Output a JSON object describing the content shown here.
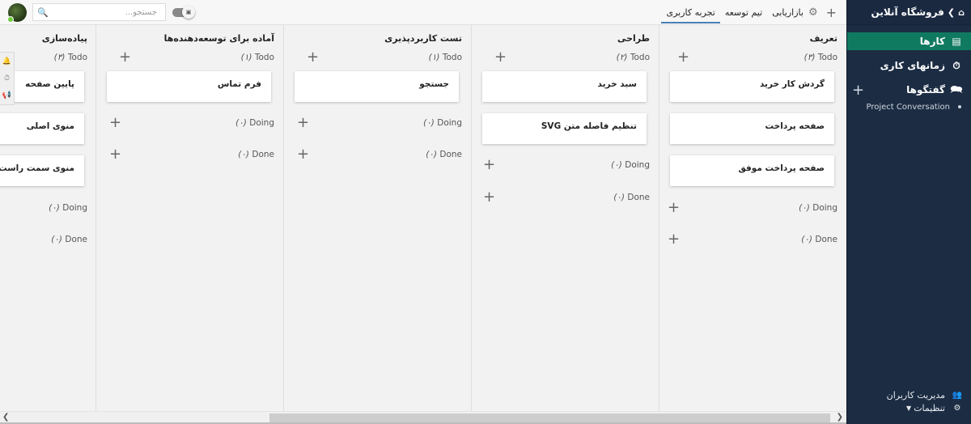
{
  "sidebar": {
    "title": "فروشگاه آنلاین",
    "items": [
      {
        "label": "کارها",
        "icon": "tasks-icon",
        "active": true
      },
      {
        "label": "زمانهای کاری",
        "icon": "stopwatch-icon",
        "active": false
      },
      {
        "label": "گفتگوها",
        "icon": "chat-icon",
        "active": false
      }
    ],
    "conversation": "Project Conversation",
    "bottom": {
      "users": "مدیریت کاربران",
      "settings": "تنظیمات"
    }
  },
  "topbar": {
    "tabs": [
      {
        "label": "تجربه کاربری",
        "active": true
      },
      {
        "label": "تیم توسعه",
        "active": false
      },
      {
        "label": "بازاریابی",
        "active": false
      }
    ],
    "search_placeholder": "جستجو..."
  },
  "board": {
    "columns": [
      {
        "title": "تعریف",
        "todo": "Todo",
        "todo_count": "(۳)",
        "doing": "Doing",
        "doing_count": "(۰)",
        "done": "Done",
        "done_count": "(۰)",
        "cards": [
          "گردش کار خرید",
          "صفحه پرداخت",
          "صفحه پرداخت موفق"
        ]
      },
      {
        "title": "طراحی",
        "todo": "Todo",
        "todo_count": "(۲)",
        "doing": "Doing",
        "doing_count": "(۰)",
        "done": "Done",
        "done_count": "(۰)",
        "cards": [
          "سبد خرید",
          "تنظیم فاصله متن SVG"
        ]
      },
      {
        "title": "تست کاربردپذیری",
        "todo": "Todo",
        "todo_count": "(۱)",
        "doing": "Doing",
        "doing_count": "(۰)",
        "done": "Done",
        "done_count": "(۰)",
        "cards": [
          "جستجو"
        ]
      },
      {
        "title": "آماده برای توسعه‌دهنده‌ها",
        "todo": "Todo",
        "todo_count": "(۱)",
        "doing": "Doing",
        "doing_count": "(۰)",
        "done": "Done",
        "done_count": "(۰)",
        "cards": [
          "فرم تماس"
        ]
      },
      {
        "title": "پیاده‌سازی",
        "todo": "Todo",
        "todo_count": "(۳)",
        "doing": "Doing",
        "doing_count": "(۰)",
        "done": "Done",
        "done_count": "(۰)",
        "cards": [
          "پایین صفحه",
          "منوی اصلی",
          "منوی سمت راست"
        ]
      }
    ]
  },
  "colors": {
    "sidebar_bg": "#1c2c43",
    "active_item": "#107a61",
    "tab_underline": "#4a7fb4"
  }
}
